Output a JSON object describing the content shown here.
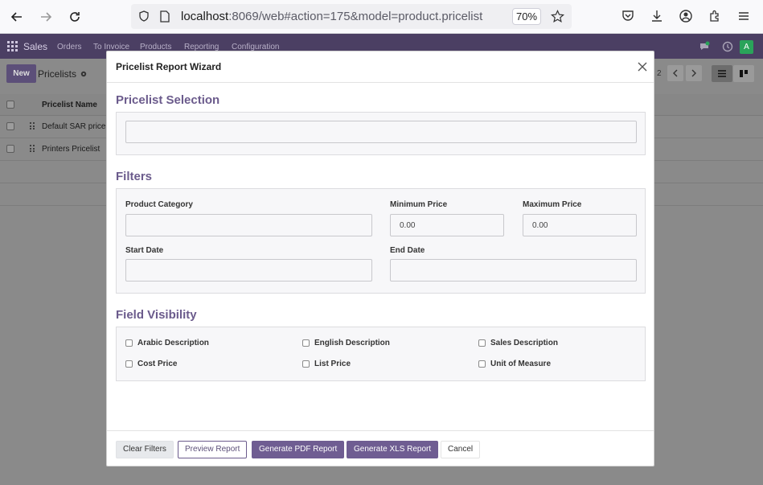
{
  "browser": {
    "url_host": "localhost",
    "url_rest": ":8069/web#action=175&model=product.pricelist",
    "zoom": "70%"
  },
  "app": {
    "brand": "Sales",
    "menu": [
      "Orders",
      "To Invoice",
      "Products",
      "Reporting",
      "Configuration"
    ],
    "avatar_initial": "A",
    "new_button": "New",
    "breadcrumb": "Pricelists",
    "pager": "2",
    "list_header": "Pricelist Name",
    "rows": [
      "Default SAR pricel",
      "Printers Pricelist"
    ]
  },
  "modal": {
    "title": "Pricelist Report Wizard",
    "pricelist_selection": {
      "title": "Pricelist Selection",
      "value": ""
    },
    "filters": {
      "title": "Filters",
      "product_category_label": "Product Category",
      "product_category_value": "",
      "min_price_label": "Minimum Price",
      "min_price_value": "0.00",
      "max_price_label": "Maximum Price",
      "max_price_value": "0.00",
      "start_date_label": "Start Date",
      "start_date_value": "",
      "end_date_label": "End Date",
      "end_date_value": ""
    },
    "field_visibility": {
      "title": "Field Visibility",
      "options": [
        "Arabic Description",
        "English Description",
        "Sales Description",
        "Cost Price",
        "List Price",
        "Unit of Measure"
      ]
    },
    "footer": {
      "clear": "Clear Filters",
      "preview": "Preview Report",
      "pdf": "Generate PDF Report",
      "xls": "Generate XLS Report",
      "cancel": "Cancel"
    }
  },
  "colors": {
    "accent": "#6b5b8c",
    "primary_button": "#6f5d92",
    "navbar": "#4b3f63"
  }
}
